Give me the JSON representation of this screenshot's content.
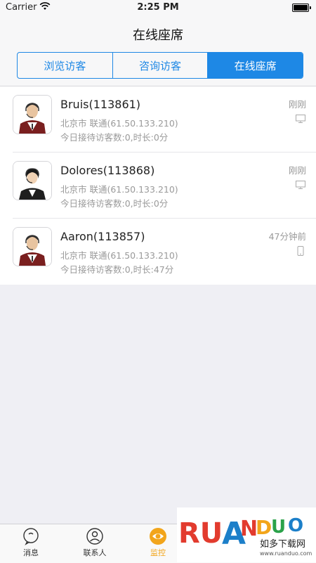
{
  "status_bar": {
    "carrier": "Carrier",
    "time": "2:25 PM"
  },
  "nav": {
    "title": "在线座席"
  },
  "segments": [
    {
      "label": "浏览访客",
      "active": false
    },
    {
      "label": "咨询访客",
      "active": false
    },
    {
      "label": "在线座席",
      "active": true
    }
  ],
  "agents": [
    {
      "name": "Bruis(113861)",
      "location": "北京市 联通(61.50.133.210)",
      "stats": "今日接待访客数:0,时长:0分",
      "time": "刚刚",
      "device": "desktop-icon"
    },
    {
      "name": "Dolores(113868)",
      "location": "北京市 联通(61.50.133.210)",
      "stats": "今日接待访客数:0,时长:0分",
      "time": "刚刚",
      "device": "desktop-icon"
    },
    {
      "name": "Aaron(113857)",
      "location": "北京市 联通(61.50.133.210)",
      "stats": "今日接待访客数:0,时长:47分",
      "time": "47分钟前",
      "device": "mobile-icon"
    }
  ],
  "tabbar": {
    "items": [
      {
        "label": "消息",
        "icon": "message-icon"
      },
      {
        "label": "联系人",
        "icon": "contacts-icon"
      },
      {
        "label": "监控",
        "icon": "monitor-eye-icon",
        "active": true
      }
    ]
  },
  "watermark": {
    "logo_text": "RUANDUO",
    "cn_text": "如多下载网",
    "url": "www.ruanduo.com"
  },
  "colors": {
    "accent": "#1e88e5",
    "tab_active": "#f2a51b",
    "secondary_text": "#9a9a9a"
  }
}
